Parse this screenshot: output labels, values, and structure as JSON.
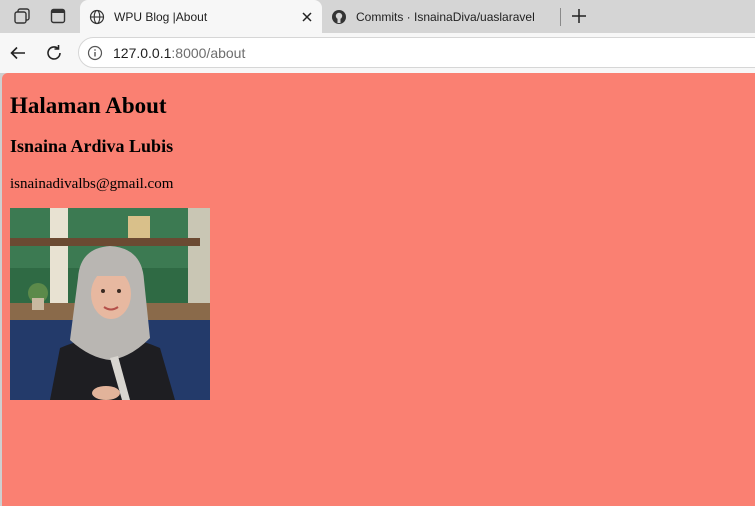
{
  "browser": {
    "tabs": [
      {
        "title": "WPU Blog |About",
        "active": true
      },
      {
        "title": "Commits · IsnainaDiva/uaslaravel",
        "active": false
      }
    ],
    "address": {
      "host": "127.0.0.1",
      "port_path": ":8000/about"
    }
  },
  "page": {
    "heading": "Halaman About",
    "name": "Isnaina Ardiva Lubis",
    "email": "isnainadivalbs@gmail.com",
    "background_color": "#fa8072"
  },
  "icons": {
    "workspaces": "workspaces-icon",
    "tab_actions": "tab-actions-icon",
    "globe": "globe-icon",
    "github": "github-icon",
    "close": "close-icon",
    "new_tab": "plus-icon",
    "back": "back-arrow-icon",
    "reload": "reload-icon",
    "info": "info-icon"
  }
}
